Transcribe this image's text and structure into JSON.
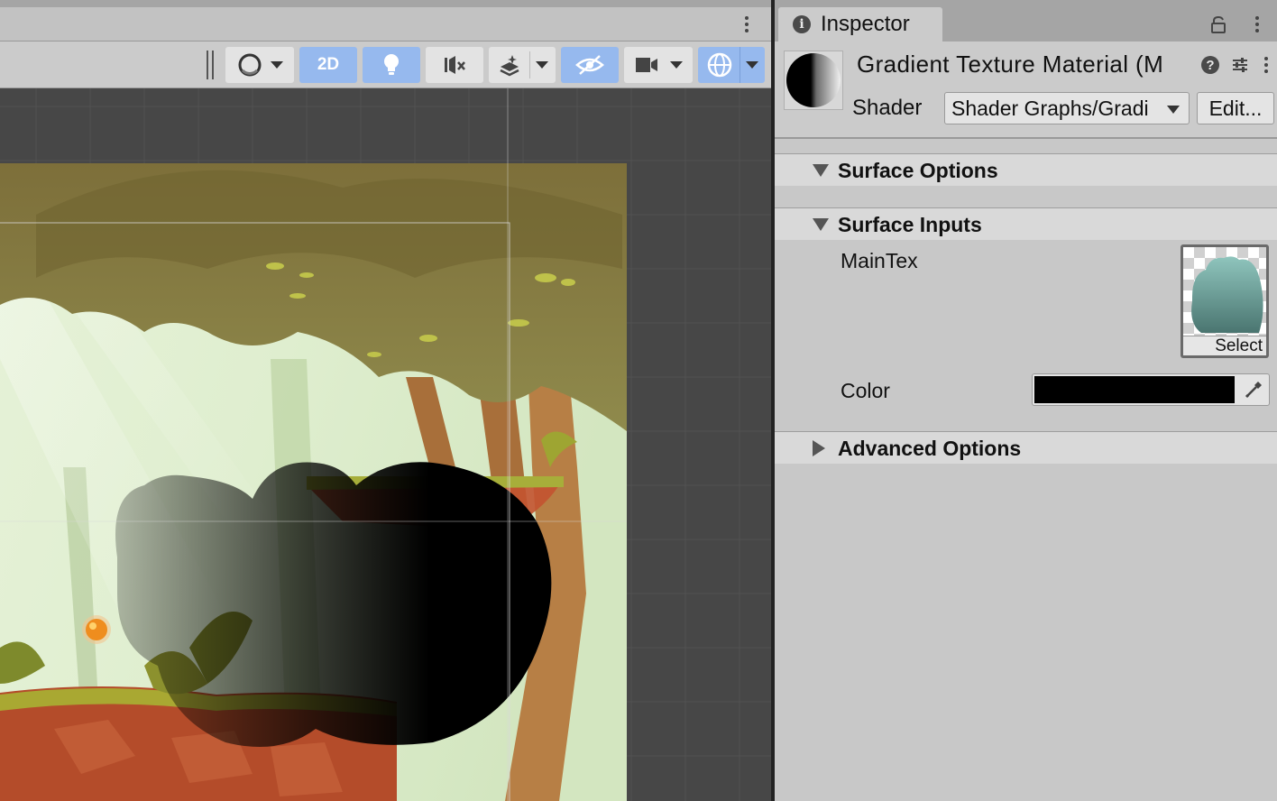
{
  "scene_toolbar": {
    "mode_2d_label": "2D"
  },
  "inspector": {
    "tab_label": "Inspector",
    "info_icon_glyph": "i",
    "material_title": "Gradient Texture Material (M",
    "help_icon_glyph": "?",
    "shader_label": "Shader",
    "shader_value": "Shader Graphs/Gradi",
    "edit_button_label": "Edit...",
    "sections": {
      "surface_options": "Surface Options",
      "surface_inputs": "Surface Inputs",
      "advanced_options": "Advanced Options"
    },
    "properties": {
      "maintex_label": "MainTex",
      "texture_select_label": "Select",
      "color_label": "Color",
      "color_value": "#000000"
    }
  },
  "icons": [
    "kebab-menu-icon",
    "shading-mode-icon",
    "lighting-icon",
    "audio-mute-icon",
    "effects-icon",
    "visibility-icon",
    "camera-icon",
    "gizmos-icon",
    "info-icon",
    "lock-icon",
    "help-icon",
    "preset-sliders-icon",
    "eyedropper-icon"
  ],
  "colors": {
    "toggle_on": "#96b9ee",
    "panel_bg": "#c8c8c8",
    "scene_bg": "#474747"
  }
}
